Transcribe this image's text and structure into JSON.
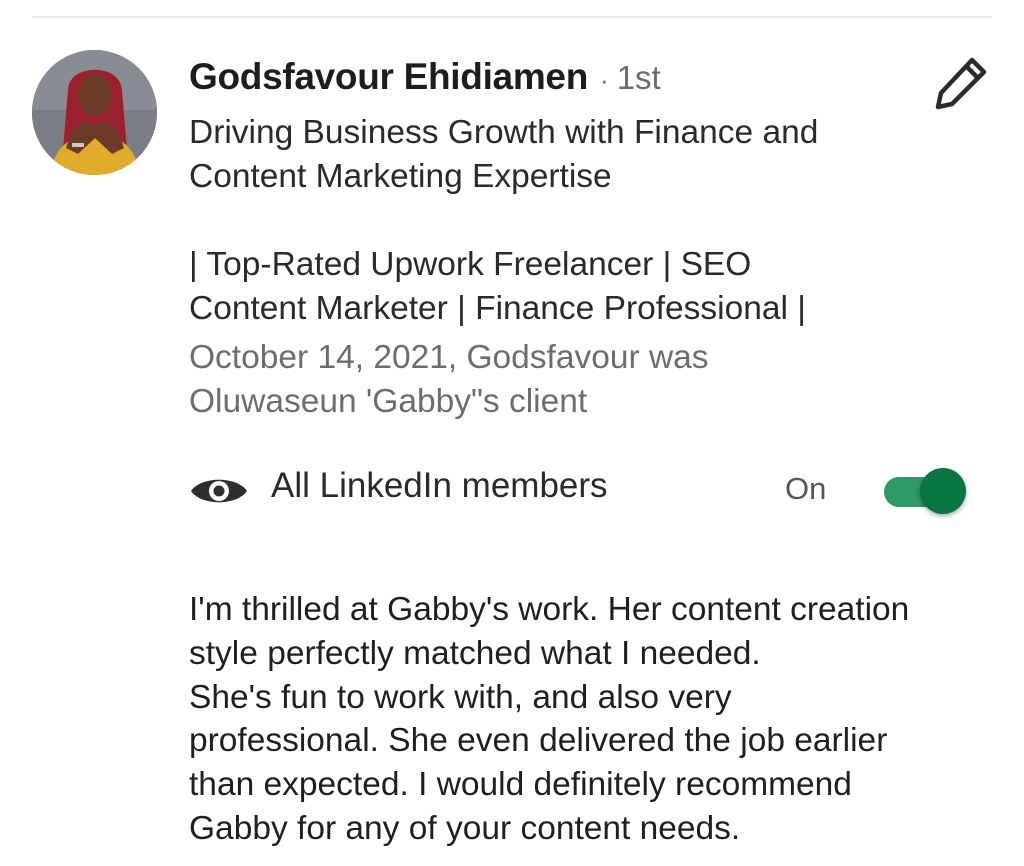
{
  "recommendation": {
    "author_name": "Godsfavour Ehidiamen",
    "separator": "·",
    "connection_degree": "1st",
    "headline_lines": [
      "Driving Business Growth with Finance and",
      "Content Marketing Expertise"
    ],
    "description_lines": [
      "| Top-Rated Upwork Freelancer | SEO",
      "Content Marketer | Finance Professional |"
    ],
    "meta_lines": [
      "October 14, 2021, Godsfavour was",
      "Oluwaseun 'Gabby\"s client"
    ],
    "visibility": {
      "label": "All LinkedIn members",
      "state_label": "On",
      "enabled": true,
      "accent_color": "#057642"
    },
    "body_lines": [
      "I'm thrilled at Gabby's work. Her content creation",
      "style perfectly matched what I needed.",
      "She's fun to work with, and also very",
      "professional. She even delivered the job earlier",
      "than expected. I would definitely recommend",
      "Gabby for any of your content needs."
    ]
  },
  "icons": {
    "edit": "pencil-icon",
    "visibility": "eye-icon",
    "avatar": "profile-photo"
  }
}
